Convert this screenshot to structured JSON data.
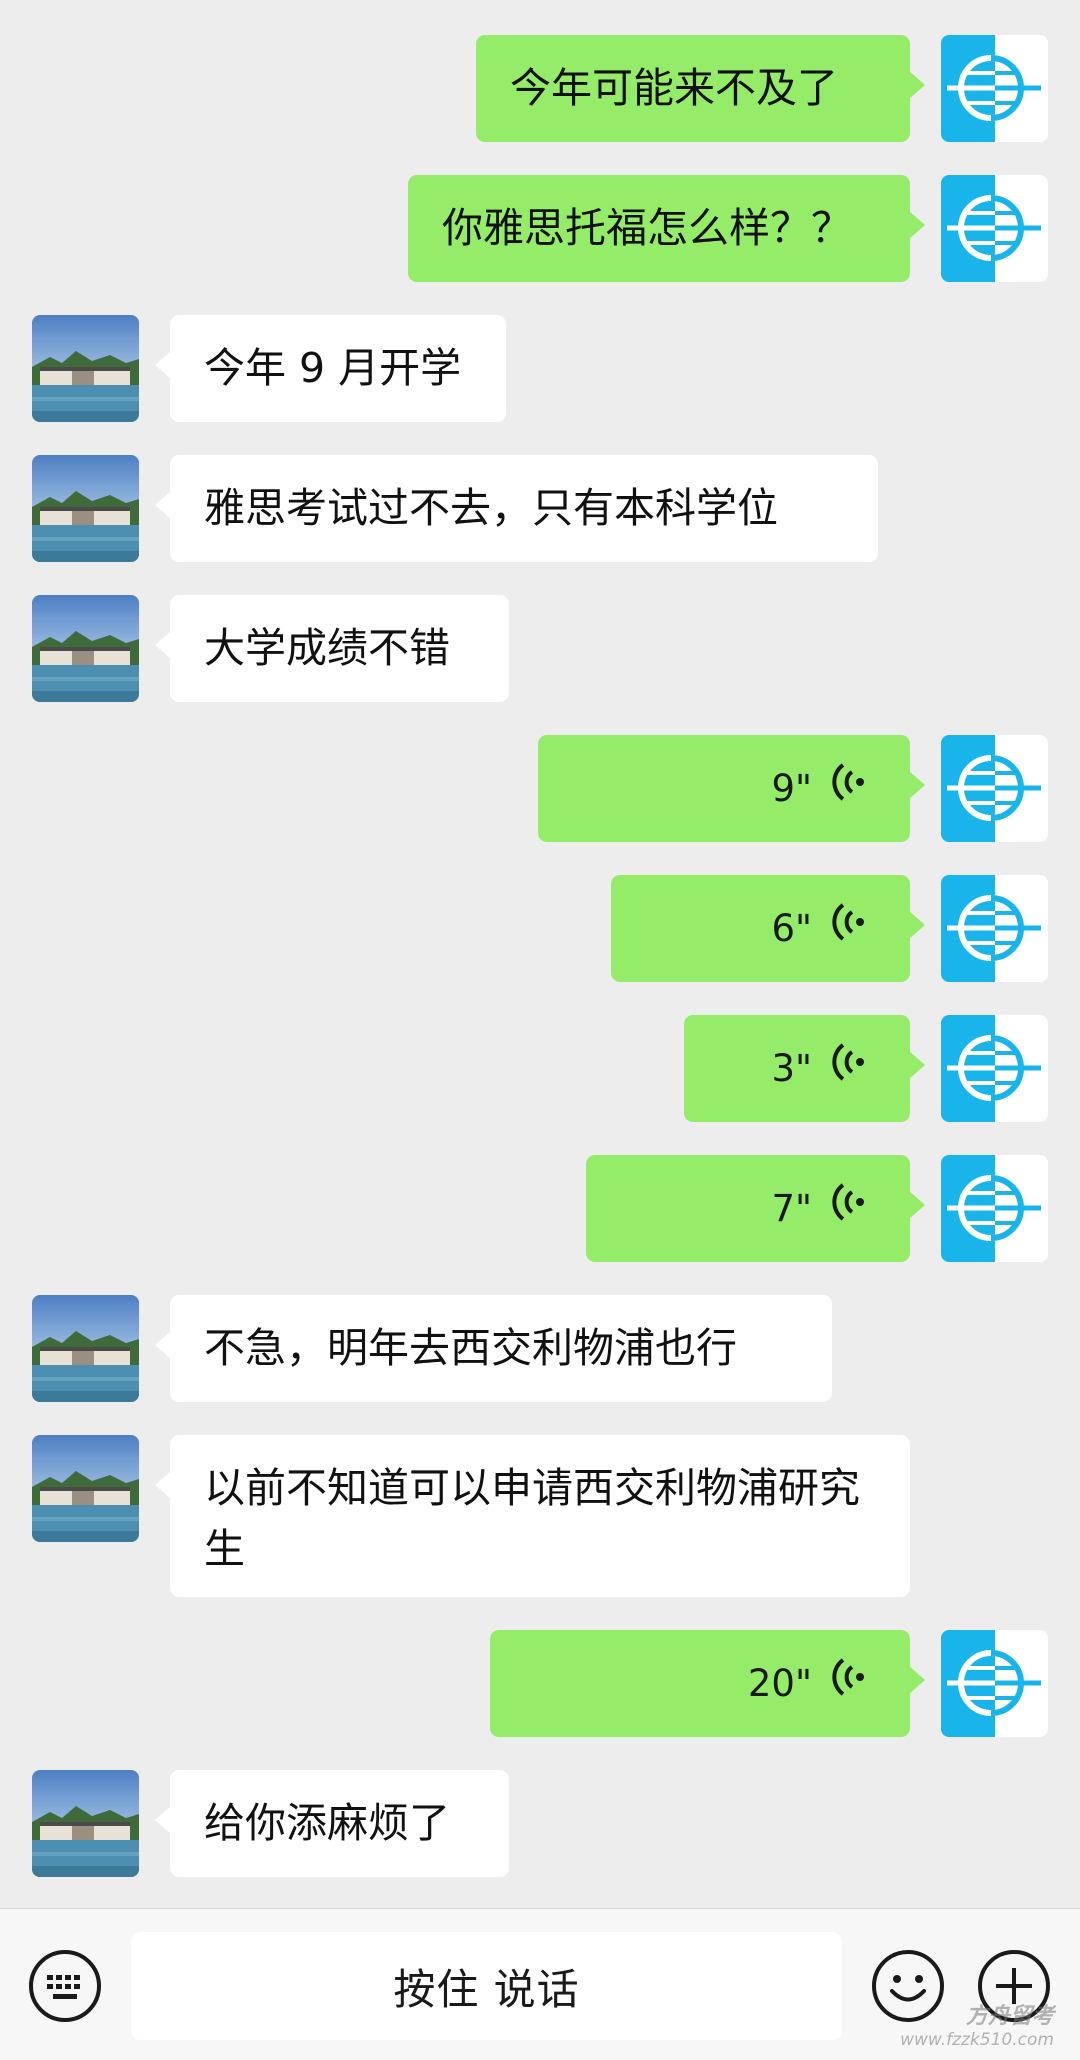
{
  "chat": {
    "messages": [
      {
        "side": "out",
        "type": "text",
        "text": "今年可能来不及了"
      },
      {
        "side": "out",
        "type": "text",
        "text": "你雅思托福怎么样？？"
      },
      {
        "side": "in",
        "type": "text",
        "text": "今年 9 月开学"
      },
      {
        "side": "in",
        "type": "text",
        "text": "雅思考试过不去，只有本科学位"
      },
      {
        "side": "in",
        "type": "text",
        "text": "大学成绩不错"
      },
      {
        "side": "out",
        "type": "voice",
        "duration": "9\""
      },
      {
        "side": "out",
        "type": "voice",
        "duration": "6\""
      },
      {
        "side": "out",
        "type": "voice",
        "duration": "3\""
      },
      {
        "side": "out",
        "type": "voice",
        "duration": "7\""
      },
      {
        "side": "in",
        "type": "text",
        "text": "不急，明年去西交利物浦也行"
      },
      {
        "side": "in",
        "type": "text",
        "text": "以前不知道可以申请西交利物浦研究生"
      },
      {
        "side": "out",
        "type": "voice",
        "duration": "20\""
      },
      {
        "side": "in",
        "type": "text",
        "text": "给你添麻烦了"
      }
    ]
  },
  "inputbar": {
    "hold_to_talk_label": "按住 说话",
    "left_icon": "keyboard-icon",
    "right_icons": [
      "emoji-icon",
      "plus-icon"
    ]
  },
  "watermark": {
    "line1": "方舟留考",
    "line2": "www.fzzk510.com"
  },
  "colors": {
    "background": "#ededed",
    "outgoing_bubble": "#95ec69",
    "incoming_bubble": "#ffffff",
    "avatar_blue": "#19b5ea"
  }
}
